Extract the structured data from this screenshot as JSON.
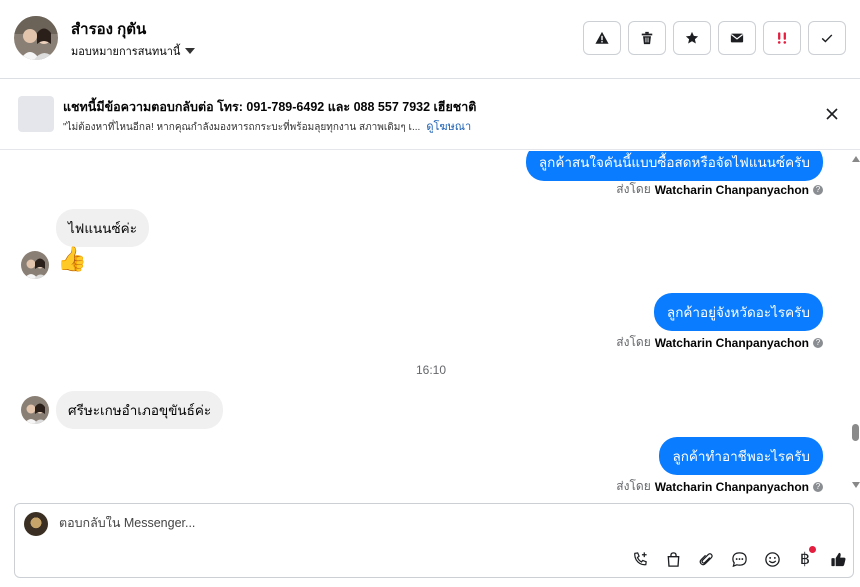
{
  "header": {
    "contact_name": "สำรอง กุตัน",
    "assign_label": "มอบหมายการสนทนานี้"
  },
  "ad": {
    "title": "แชทนี้มีข้อความตอบกลับต่อ โทร: 091-789-6492 และ 088 557 7932 เฮียชาติ",
    "body": "\"ไม่ต้องหาที่ไหนอีกล! หากคุณกำลังมองหารถกระบะที่พร้อมลุยทุกงาน สภาพเดิมๆ เ...",
    "link": "ดูโฆษณา"
  },
  "messages": {
    "out1": "ลูกค้าสนใจคันนี้แบบซื้อสดหรือจัดไฟแนนซ์ครับ",
    "in1": "ไฟแนนซ์ค่ะ",
    "in2_emoji": "👍",
    "out2": "ลูกค้าอยู่จังหวัดอะไรครับ",
    "timestamp": "16:10",
    "in3": "ศรีษะเกษอำเภอขุขันธ์ค่ะ",
    "out3": "ลูกค้าทำอาชีพอะไรครับ"
  },
  "sent_by": {
    "prefix": "ส่งโดย",
    "name": "Watcharin Chanpanyachon"
  },
  "composer": {
    "placeholder": "ตอบกลับใน Messenger..."
  },
  "colors": {
    "outgoing_bubble": "#0a7cff",
    "incoming_bubble": "#f0f0f0",
    "notification_dot": "#e41e3f",
    "flag_icon": "#e41e3f"
  },
  "icons": [
    "warning-icon",
    "trash-icon",
    "star-icon",
    "mail-icon",
    "priority-icon",
    "check-icon",
    "close-icon",
    "call-add-icon",
    "bag-icon",
    "attach-icon",
    "chat-icon",
    "emoji-icon",
    "baht-icon",
    "like-icon",
    "info-icon"
  ],
  "baht_symbol": "฿"
}
